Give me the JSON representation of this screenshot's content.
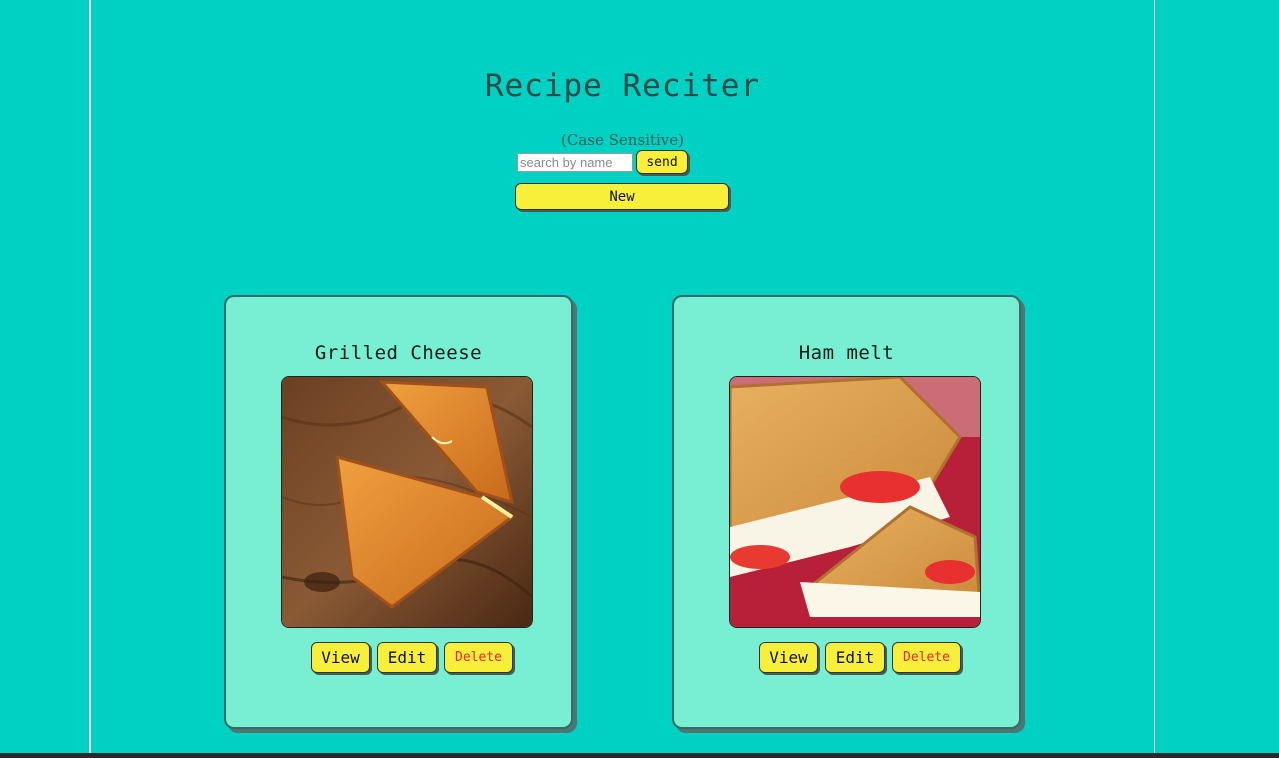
{
  "header": {
    "title": "Recipe Reciter",
    "case_note": "(Case Sensitive)"
  },
  "search": {
    "placeholder": "search by name",
    "value": "",
    "send_label": "send"
  },
  "new_label": "New",
  "recipes": [
    {
      "name": "Grilled Cheese",
      "image": "grilled-cheese-photo",
      "view_label": "View",
      "edit_label": "Edit",
      "delete_label": "Delete"
    },
    {
      "name": "Ham melt",
      "image": "ham-melt-photo",
      "view_label": "View",
      "edit_label": "Edit",
      "delete_label": "Delete"
    }
  ],
  "colors": {
    "background": "#00d1c2",
    "card": "#78efd2",
    "button": "#f7ef3a",
    "delete_text": "#e8262a"
  }
}
